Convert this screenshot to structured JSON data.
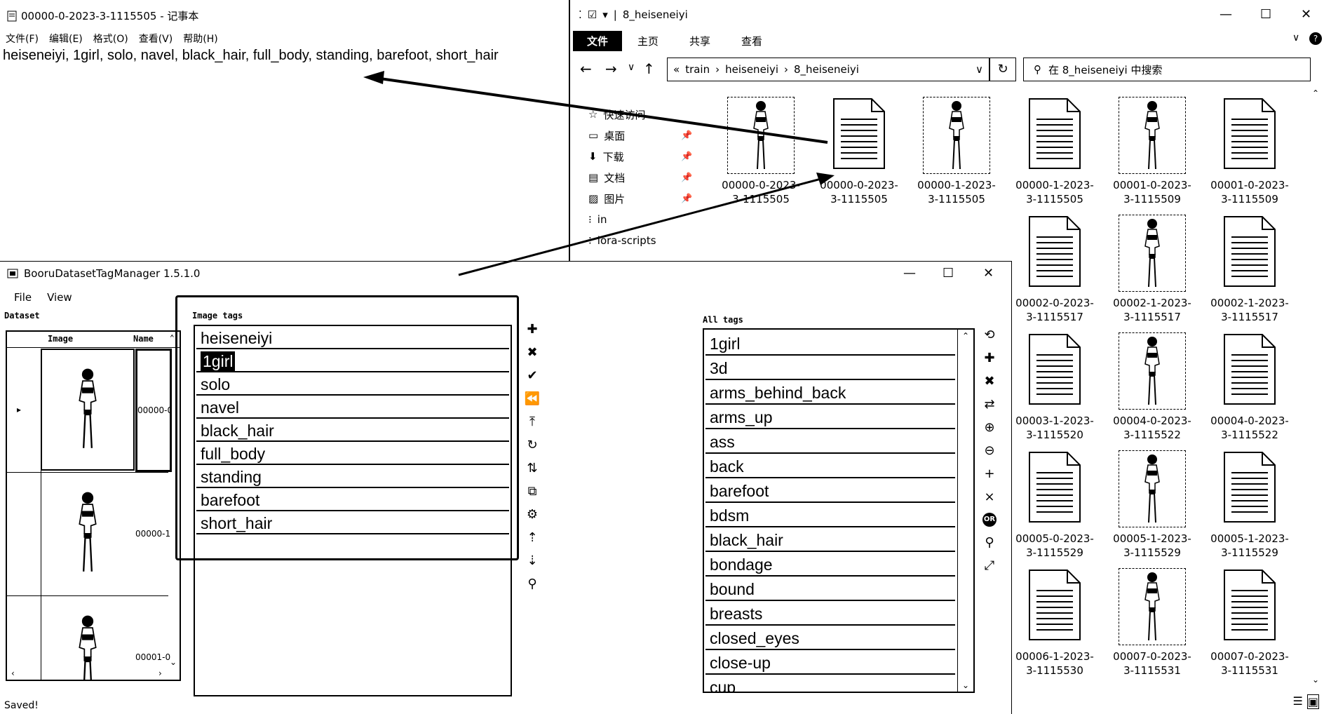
{
  "notepad": {
    "title": "00000-0-2023-3-1115505 - 记事本",
    "menu": [
      "文件(F)",
      "编辑(E)",
      "格式(O)",
      "查看(V)",
      "帮助(H)"
    ],
    "content": "heiseneiyi, 1girl, solo, navel, black_hair, full_body, standing, barefoot, short_hair"
  },
  "explorer": {
    "title": "8_heiseneiyi",
    "ribbon": {
      "file": "文件",
      "tabs": [
        "主页",
        "共享",
        "查看"
      ]
    },
    "address": {
      "prefix": "«",
      "segments": [
        "train",
        "heiseneiyi",
        "8_heiseneiyi"
      ]
    },
    "search_placeholder": "在 8_heiseneiyi 中搜索",
    "nav_items": [
      {
        "label": "快速访问",
        "icon": "star-icon",
        "pinned": false
      },
      {
        "label": "桌面",
        "icon": "desktop-icon",
        "pinned": true
      },
      {
        "label": "下载",
        "icon": "download-icon",
        "pinned": true
      },
      {
        "label": "文档",
        "icon": "document-icon",
        "pinned": true
      },
      {
        "label": "图片",
        "icon": "picture-icon",
        "pinned": true
      },
      {
        "label": "in",
        "icon": "folder-icon",
        "pinned": false
      },
      {
        "label": "lora-scripts",
        "icon": "folder-icon",
        "pinned": false
      }
    ],
    "files": [
      {
        "name": "00000-0-2023-\n3-1115505",
        "kind": "image"
      },
      {
        "name": "00000-0-2023-\n3-1115505",
        "kind": "text"
      },
      {
        "name": "00000-1-2023-\n3-1115505",
        "kind": "image"
      },
      {
        "name": "00000-1-2023-\n3-1115505",
        "kind": "text"
      },
      {
        "name": "00001-0-2023-\n3-1115509",
        "kind": "image"
      },
      {
        "name": "00001-0-2023-\n3-1115509",
        "kind": "text"
      },
      {
        "name": "00002-0-2023-\n3-1115517",
        "kind": "text"
      },
      {
        "name": "00002-1-2023-\n3-1115517",
        "kind": "image"
      },
      {
        "name": "00002-1-2023-\n3-1115517",
        "kind": "text"
      },
      {
        "name": "00003-1-2023-\n3-1115520",
        "kind": "text"
      },
      {
        "name": "00004-0-2023-\n3-1115522",
        "kind": "image"
      },
      {
        "name": "00004-0-2023-\n3-1115522",
        "kind": "text"
      },
      {
        "name": "00005-0-2023-\n3-1115529",
        "kind": "text"
      },
      {
        "name": "00005-1-2023-\n3-1115529",
        "kind": "image"
      },
      {
        "name": "00005-1-2023-\n3-1115529",
        "kind": "text"
      },
      {
        "name": "00006-1-2023-\n3-1115530",
        "kind": "text"
      },
      {
        "name": "00007-0-2023-\n3-1115531",
        "kind": "image"
      },
      {
        "name": "00007-0-2023-\n3-1115531",
        "kind": "text"
      }
    ]
  },
  "booru": {
    "title": "BooruDatasetTagManager 1.5.1.0",
    "menu": [
      "File",
      "View"
    ],
    "dataset_label": "Dataset",
    "dataset_columns": [
      "Image",
      "Name"
    ],
    "dataset_rows": [
      {
        "name": "00000-0",
        "selected": true
      },
      {
        "name": "00000-1",
        "selected": false
      },
      {
        "name": "00001-0",
        "selected": false
      }
    ],
    "image_tags_label": "Image tags",
    "image_tags": [
      "heiseneiyi",
      "1girl",
      "solo",
      "navel",
      "black_hair",
      "full_body",
      "standing",
      "barefoot",
      "short_hair"
    ],
    "editing_tag_index": 1,
    "all_tags_label": "All tags",
    "all_tags": [
      "1girl",
      "3d",
      "arms_behind_back",
      "arms_up",
      "ass",
      "back",
      "barefoot",
      "bdsm",
      "black_hair",
      "bondage",
      "bound",
      "breasts",
      "closed_eyes",
      "close-up",
      "cup"
    ],
    "status": "Saved!"
  }
}
